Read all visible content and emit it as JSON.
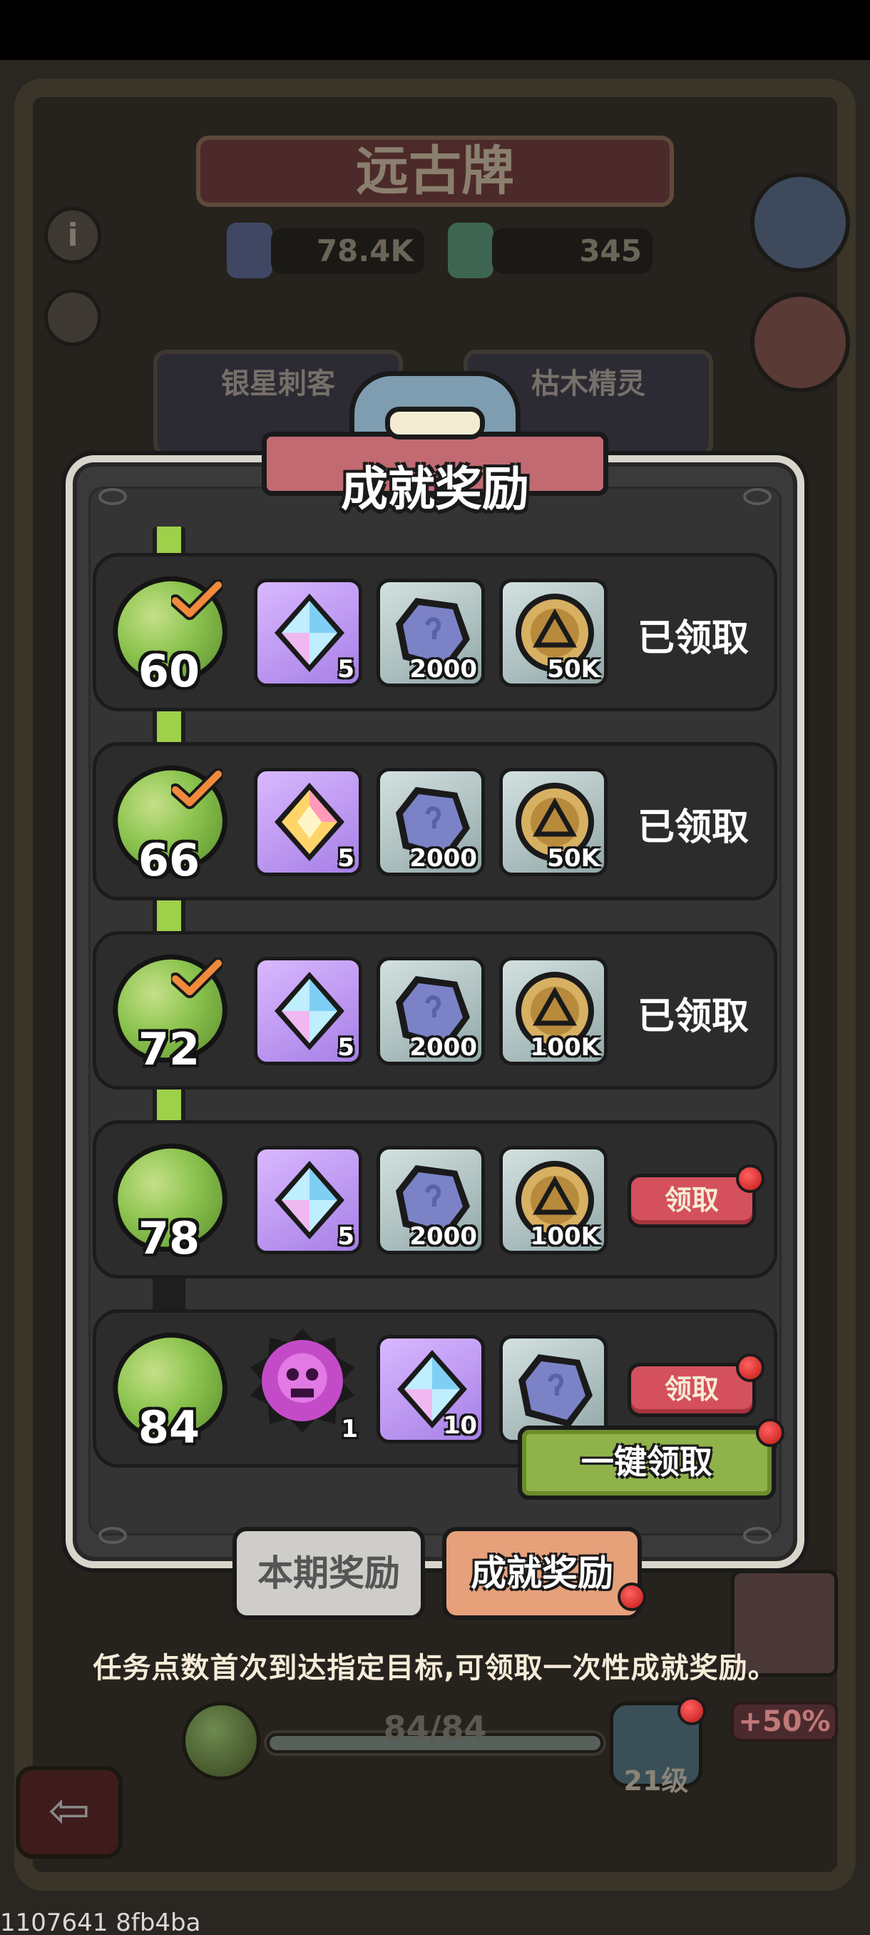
{
  "background": {
    "title": "远古牌",
    "currency_1": "78.4K",
    "currency_2": "345",
    "info_button": "i",
    "card_left": "银星刺客",
    "card_right": "枯木精灵",
    "description": "任务点数首次到达指定目标,可领取一次性成就奖励。",
    "progress_label": "84/84",
    "progress_value": 1.0,
    "level_label": "21级",
    "hero_bonus": "+50%",
    "back_arrow": "⇦"
  },
  "modal": {
    "title": "成就奖励",
    "rows": [
      {
        "level": "60",
        "claimed": true,
        "items": [
          {
            "icon": "crystal-blue-icon",
            "count": "5"
          },
          {
            "icon": "ore-icon",
            "count": "2000"
          },
          {
            "icon": "gold-coin-icon",
            "count": "50K"
          }
        ],
        "status": "已领取"
      },
      {
        "level": "66",
        "claimed": true,
        "items": [
          {
            "icon": "crystal-gold-icon",
            "count": "5"
          },
          {
            "icon": "ore-icon",
            "count": "2000"
          },
          {
            "icon": "gold-coin-icon",
            "count": "50K"
          }
        ],
        "status": "已领取"
      },
      {
        "level": "72",
        "claimed": true,
        "items": [
          {
            "icon": "crystal-blue-icon",
            "count": "5"
          },
          {
            "icon": "ore-icon",
            "count": "2000"
          },
          {
            "icon": "gold-coin-icon",
            "count": "100K"
          }
        ],
        "status": "已领取"
      },
      {
        "level": "78",
        "claimed": false,
        "items": [
          {
            "icon": "crystal-blue-icon",
            "count": "5"
          },
          {
            "icon": "ore-icon",
            "count": "2000"
          },
          {
            "icon": "gold-coin-icon",
            "count": "100K"
          }
        ],
        "status": "领取"
      },
      {
        "level": "84",
        "claimed": false,
        "items": [
          {
            "icon": "skull-emblem-icon",
            "count": "1"
          },
          {
            "icon": "crystal-blue-icon",
            "count": "10"
          },
          {
            "icon": "ore-icon",
            "count": ""
          }
        ],
        "status": "领取"
      }
    ],
    "claim_all_label": "一键领取"
  },
  "tabs": {
    "current_period": "本期奖励",
    "achievement": "成就奖励"
  },
  "watermark": "1107641 8fb4ba",
  "colors": {
    "claim_red": "#d4505c",
    "claim_all_green": "#8fb24a",
    "track_green": "#9ed04a",
    "tab_active": "#e6a07a"
  }
}
